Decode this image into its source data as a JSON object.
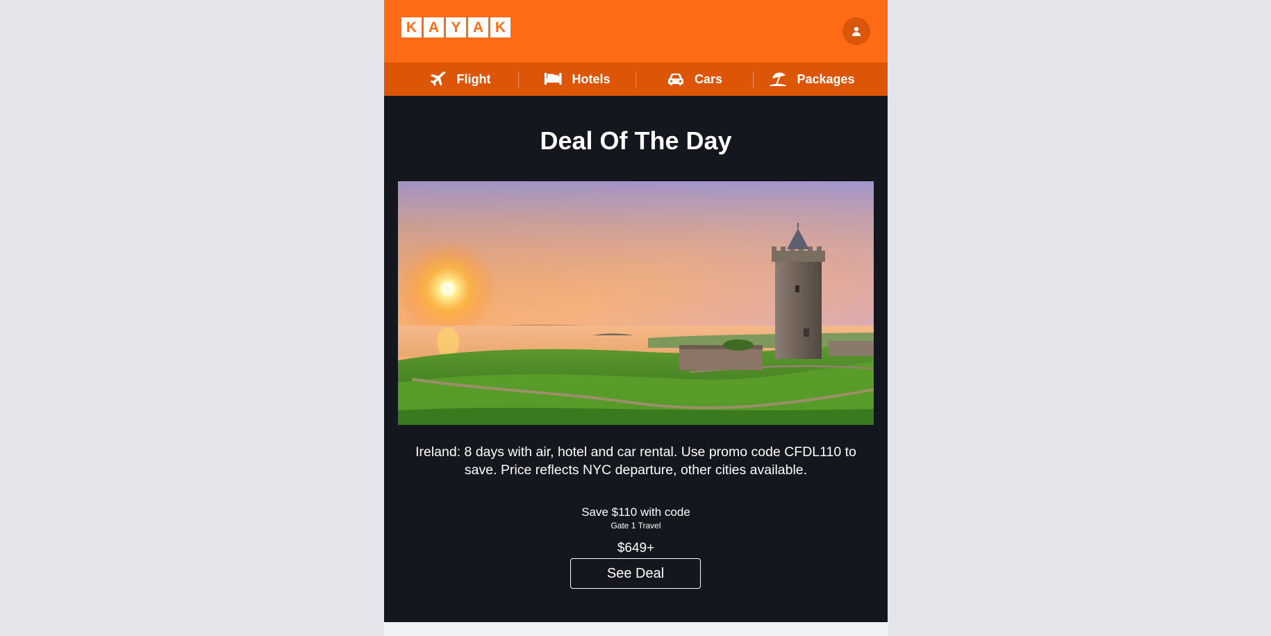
{
  "brand": {
    "letters": [
      "K",
      "A",
      "Y",
      "A",
      "K"
    ],
    "color": "#ff6b14"
  },
  "header": {
    "account_icon": "user-icon"
  },
  "nav": {
    "items": [
      {
        "label": "Flight",
        "icon": "plane-icon"
      },
      {
        "label": "Hotels",
        "icon": "bed-icon"
      },
      {
        "label": "Cars",
        "icon": "car-icon"
      },
      {
        "label": "Packages",
        "icon": "beach-umbrella-icon"
      }
    ]
  },
  "deal": {
    "title": "Deal Of The Day",
    "description": "Ireland: 8 days with air, hotel and car rental. Use promo code CFDL110 to save. Price reflects NYC departure, other cities available.",
    "save_text": "Save $110 with code",
    "provider": "Gate 1 Travel",
    "price": "$649+",
    "cta_label": "See Deal"
  }
}
